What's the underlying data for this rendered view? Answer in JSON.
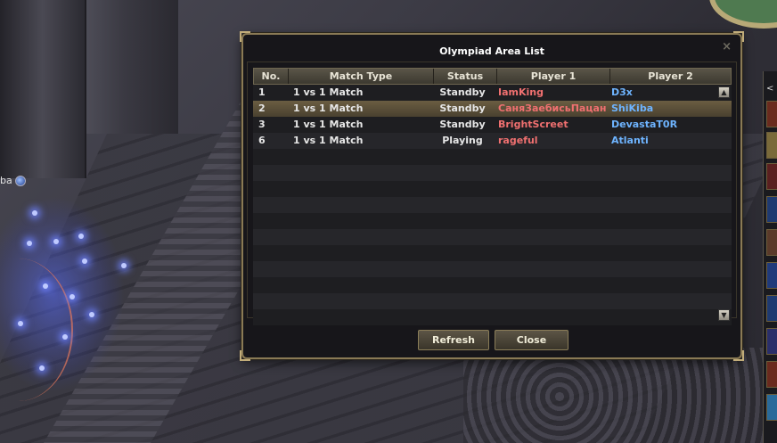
{
  "scene": {
    "character_name": "ba"
  },
  "dialog": {
    "title": "Olympiad Area List",
    "close_glyph": "×",
    "columns": [
      "No.",
      "Match Type",
      "Status",
      "Player 1",
      "Player 2"
    ],
    "rows": [
      {
        "no": "1",
        "match_type": "1 vs 1 Match",
        "status": "Standby",
        "player1": "IamKing",
        "player2": "D3x"
      },
      {
        "no": "2",
        "match_type": "1 vs 1 Match",
        "status": "Standby",
        "player1": "СаняЗаебисьПацан",
        "player2": "ShiKiba"
      },
      {
        "no": "3",
        "match_type": "1 vs 1 Match",
        "status": "Standby",
        "player1": "BrightScreet",
        "player2": "DevastaT0R"
      },
      {
        "no": "6",
        "match_type": "1 vs 1 Match",
        "status": "Playing",
        "player1": "rageful",
        "player2": "Atlanti"
      }
    ],
    "selected_row": 1,
    "buttons": {
      "refresh": "Refresh",
      "close": "Close"
    },
    "colors": {
      "player1": "#f07070",
      "player2": "#6eb4ff",
      "frame": "#8a7a55"
    }
  },
  "sidebar": {
    "arrow": "<"
  }
}
